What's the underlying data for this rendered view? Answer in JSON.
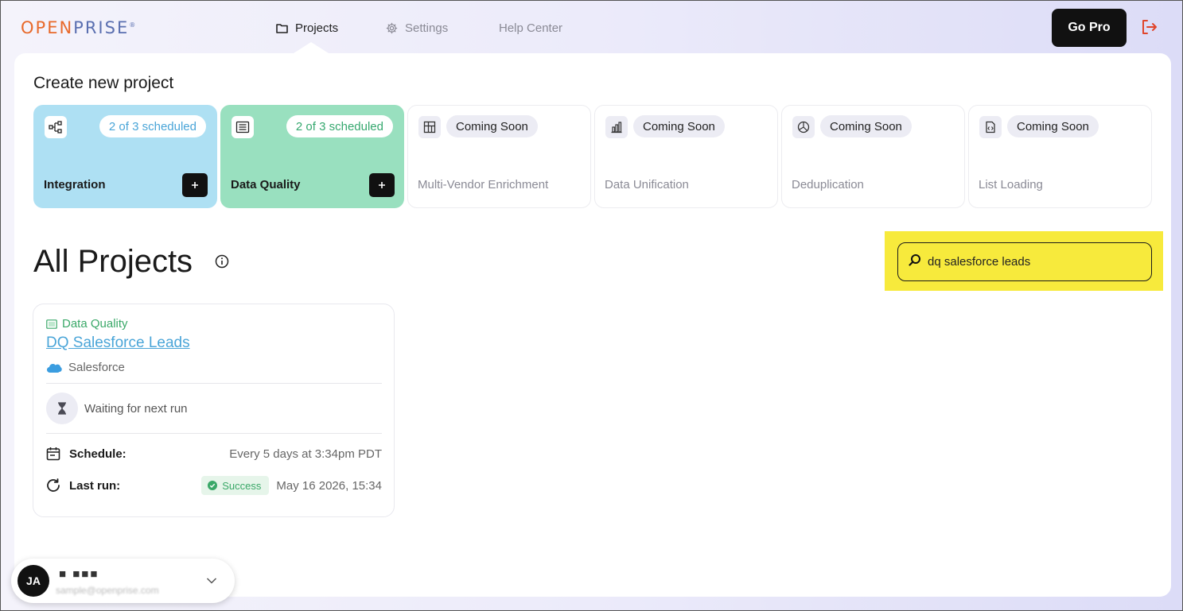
{
  "app": {
    "logo_open": "OPEN",
    "logo_prise": "PRISE",
    "logo_mark": "®"
  },
  "nav": {
    "projects": "Projects",
    "settings": "Settings",
    "help": "Help Center",
    "go_pro": "Go Pro"
  },
  "create": {
    "title": "Create new project",
    "cards": [
      {
        "label": "Integration",
        "badge": "2 of 3 scheduled",
        "icon": "integration-icon"
      },
      {
        "label": "Data Quality",
        "badge": "2 of 3 scheduled",
        "icon": "data-quality-icon"
      },
      {
        "label": "Multi-Vendor Enrichment",
        "badge": "Coming Soon",
        "icon": "enrichment-icon"
      },
      {
        "label": "Data Unification",
        "badge": "Coming Soon",
        "icon": "bar-chart-icon"
      },
      {
        "label": "Deduplication",
        "badge": "Coming Soon",
        "icon": "pie-chart-icon"
      },
      {
        "label": "List Loading",
        "badge": "Coming Soon",
        "icon": "code-file-icon"
      }
    ]
  },
  "projects": {
    "title": "All Projects",
    "search_value": "dq salesforce leads",
    "items": [
      {
        "type": "Data Quality",
        "name": "DQ Salesforce Leads",
        "source": "Salesforce",
        "status": "Waiting for next run",
        "schedule_label": "Schedule:",
        "schedule_value": "Every 5 days at 3:34pm PDT",
        "last_run_label": "Last run:",
        "last_run_status": "Success",
        "last_run_value": "May 16 2026, 15:34"
      }
    ]
  },
  "user": {
    "initials": "JA",
    "name": "■ ■■■",
    "email": "sample@openprise.com"
  },
  "colors": {
    "accent_orange": "#e8692a",
    "integration_card": "#aee0f3",
    "data_quality_card": "#99e0bf",
    "search_highlight": "#f7ea3c",
    "link_blue": "#4aa5d8",
    "success_green": "#3aa868"
  }
}
